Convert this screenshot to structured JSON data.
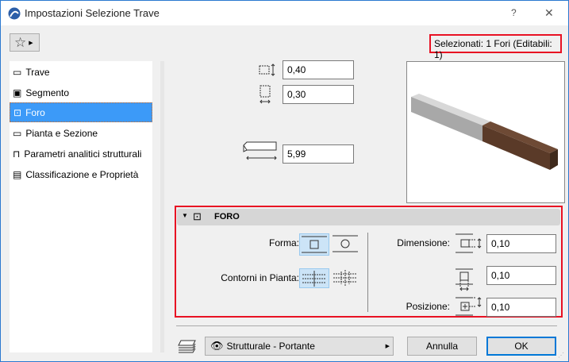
{
  "window": {
    "title": "Impostazioni Selezione Trave",
    "help": "?",
    "close": "✕"
  },
  "selection_info": "Selezionati: 1 Fori (Editabili: 1)",
  "sidebar": {
    "items": [
      {
        "label": "Trave"
      },
      {
        "label": "Segmento"
      },
      {
        "label": "Foro",
        "selected": true
      },
      {
        "label": "Pianta e Sezione"
      },
      {
        "label": "Parametri analitici strutturali"
      },
      {
        "label": "Classificazione e Proprietà"
      }
    ]
  },
  "dims": {
    "height": "0,40",
    "width": "0,30",
    "length": "5,99"
  },
  "foro": {
    "title": "FORO",
    "forma_label": "Forma:",
    "contorni_label": "Contorni in Pianta:",
    "dimensione_label": "Dimensione:",
    "posizione_label": "Posizione:",
    "dim1": "0,10",
    "dim2": "0,10",
    "pos": "0,10"
  },
  "footer": {
    "layer": "Strutturale - Portante",
    "cancel": "Annulla",
    "ok": "OK"
  },
  "colors": {
    "accent": "#3c9af8",
    "highlight": "#e81123"
  }
}
